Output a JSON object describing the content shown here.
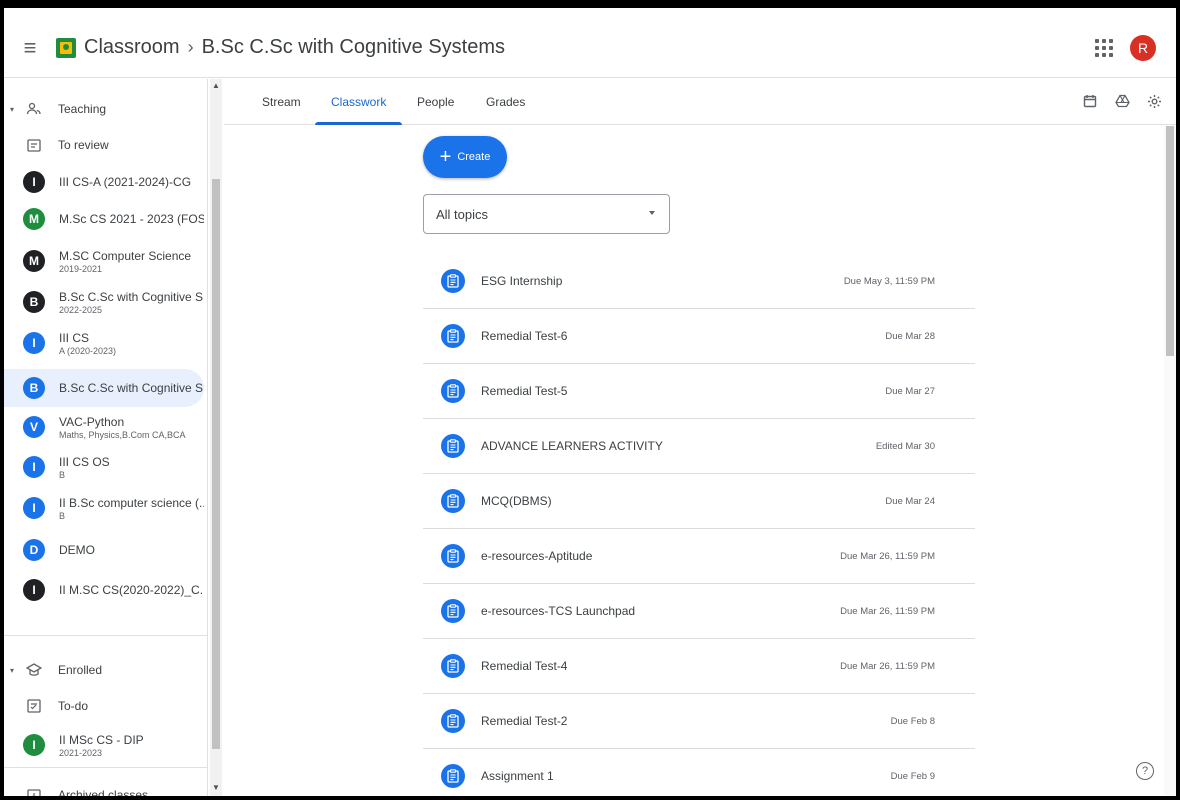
{
  "header": {
    "app_name": "Classroom",
    "separator": "›",
    "class_name": "B.Sc C.Sc with Cognitive Systems",
    "account_initial": "R",
    "colors": {
      "account": "#d93025",
      "brand_green": "#1e8e3e",
      "brand_yellow": "#fbbc04"
    }
  },
  "sidebar": {
    "teaching_label": "Teaching",
    "to_review_label": "To review",
    "teaching_classes": [
      {
        "initial": "I",
        "name": "III CS-A (2021-2024)-CG",
        "sub": "",
        "color": "#202124"
      },
      {
        "initial": "M",
        "name": "M.Sc CS 2021 - 2023 (FOS...",
        "sub": "",
        "color": "#1e8e3e"
      },
      {
        "initial": "M",
        "name": "M.SC Computer Science",
        "sub": "2019-2021",
        "color": "#202124"
      },
      {
        "initial": "B",
        "name": "B.Sc C.Sc with Cognitive S...",
        "sub": "2022-2025",
        "color": "#202124"
      },
      {
        "initial": "I",
        "name": "III CS",
        "sub": "A (2020-2023)",
        "color": "#1a73e8"
      },
      {
        "initial": "B",
        "name": "B.Sc C.Sc with Cognitive S...",
        "sub": "",
        "color": "#1a73e8",
        "selected": true
      },
      {
        "initial": "V",
        "name": "VAC-Python",
        "sub": "Maths, Physics,B.Com CA,BCA",
        "color": "#1a73e8"
      },
      {
        "initial": "I",
        "name": "III CS OS",
        "sub": "B",
        "color": "#1a73e8"
      },
      {
        "initial": "I",
        "name": "II B.Sc computer science (...",
        "sub": "B",
        "color": "#1a73e8"
      },
      {
        "initial": "D",
        "name": "DEMO",
        "sub": "",
        "color": "#1a73e8"
      },
      {
        "initial": "I",
        "name": "II M.SC CS(2020-2022)_C...",
        "sub": "",
        "color": "#202124"
      }
    ],
    "enrolled_label": "Enrolled",
    "todo_label": "To-do",
    "enrolled_classes": [
      {
        "initial": "I",
        "name": "II MSc CS - DIP",
        "sub": "2021-2023",
        "color": "#1e8e3e"
      }
    ],
    "archived_label": "Archived classes"
  },
  "tabs": [
    {
      "label": "Stream",
      "active": false
    },
    {
      "label": "Classwork",
      "active": true
    },
    {
      "label": "People",
      "active": false
    },
    {
      "label": "Grades",
      "active": false
    }
  ],
  "toolbar_icons": [
    "calendar-icon",
    "drive-icon",
    "settings-icon"
  ],
  "main": {
    "create_label": "Create",
    "topic_filter": "All topics",
    "items": [
      {
        "title": "ESG Internship",
        "due": "Due May 3, 11:59 PM"
      },
      {
        "title": "Remedial Test-6",
        "due": "Due Mar 28"
      },
      {
        "title": "Remedial Test-5",
        "due": "Due Mar 27"
      },
      {
        "title": "ADVANCE LEARNERS ACTIVITY",
        "due": "Edited Mar 30"
      },
      {
        "title": "MCQ(DBMS)",
        "due": "Due Mar 24"
      },
      {
        "title": "e-resources-Aptitude",
        "due": "Due Mar 26, 11:59 PM"
      },
      {
        "title": "e-resources-TCS Launchpad",
        "due": "Due Mar 26, 11:59 PM"
      },
      {
        "title": "Remedial Test-4",
        "due": "Due Mar 26, 11:59 PM"
      },
      {
        "title": "Remedial Test-2",
        "due": "Due Feb 8"
      },
      {
        "title": "Assignment 1",
        "due": "Due Feb 9"
      }
    ],
    "accent": "#1a73e8"
  },
  "help_label": "?"
}
